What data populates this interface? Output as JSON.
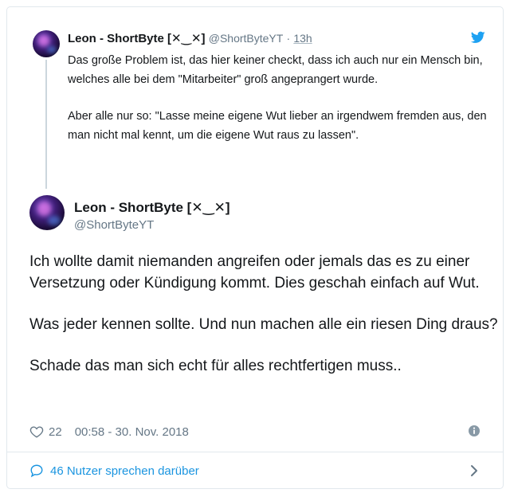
{
  "parent_tweet": {
    "name": "Leon - ShortByte [✕‿✕]",
    "handle": "@ShortByteYT",
    "separator": "·",
    "time": "13h",
    "paragraphs": [
      "Das große Problem ist, das hier keiner checkt, dass ich auch nur ein Mensch bin, welches alle bei dem \"Mitarbeiter\" groß angeprangert wurde.",
      "Aber alle nur so: \"Lasse meine eigene Wut lieber an irgendwem fremden aus, den man nicht mal kennt, um die eigene Wut raus zu lassen\"."
    ]
  },
  "main_tweet": {
    "name": "Leon - ShortByte [✕‿✕]",
    "handle": "@ShortByteYT",
    "paragraphs": [
      "Ich wollte damit niemanden angreifen oder jemals das es zu einer Versetzung oder Kündigung kommt. Dies geschah einfach auf Wut.",
      "Was jeder kennen sollte. Und nun machen alle ein riesen Ding draus?",
      "Schade das man sich echt für alles rechtfertigen muss.."
    ],
    "likes": "22",
    "timestamp": "00:58 - 30. Nov. 2018"
  },
  "footer": {
    "label": "46 Nutzer sprechen darüber"
  },
  "icons": {
    "brand": "twitter-bird-icon",
    "like": "heart-icon",
    "info": "info-icon",
    "conversation": "speech-bubble-icon",
    "more": "chevron-right-icon"
  },
  "colors": {
    "accent": "#1b95e0",
    "bird": "#1da1f2",
    "text": "#14171a",
    "secondary": "#657786",
    "border": "#e1e8ed",
    "thread_line": "#ccd6dd"
  }
}
